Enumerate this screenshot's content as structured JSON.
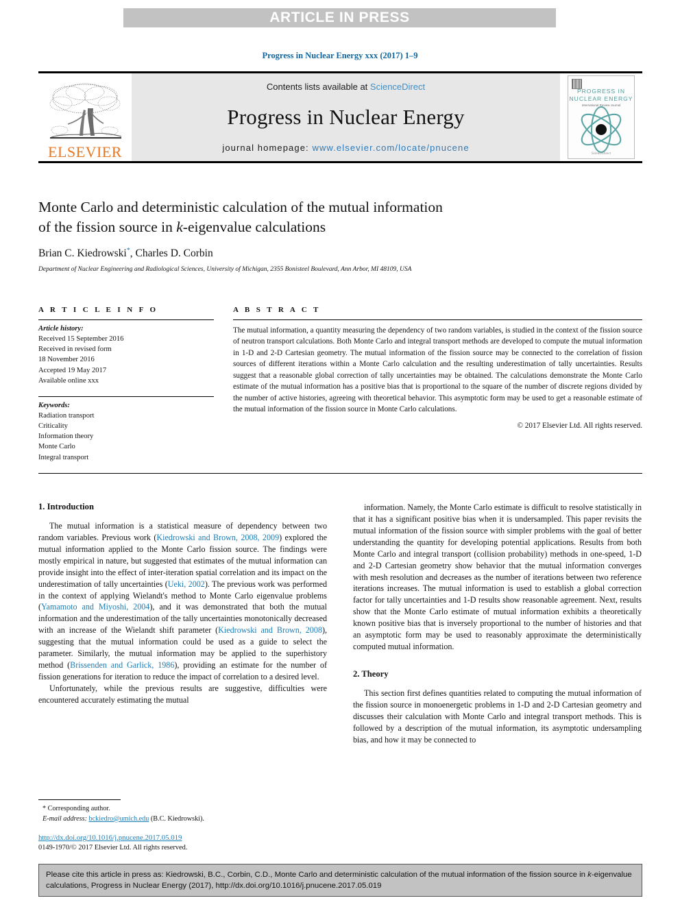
{
  "banner": {
    "text": "ARTICLE IN PRESS"
  },
  "running_head": "Progress in Nuclear Energy xxx (2017) 1–9",
  "masthead": {
    "contents_prefix": "Contents lists available at ",
    "sciencedirect": "ScienceDirect",
    "journal_title": "Progress in Nuclear Energy",
    "homepage_prefix": "journal homepage: ",
    "homepage_url": "www.elsevier.com/locate/pnucene",
    "publisher": "ELSEVIER",
    "cover": {
      "line1": "PROGRESS IN",
      "line2": "NUCLEAR ENERGY",
      "subtitle": "International Review Journal",
      "footer": "ScienceDirect"
    }
  },
  "article": {
    "title_line1": "Monte Carlo and deterministic calculation of the mutual information",
    "title_line2_a": "of the fission source in ",
    "title_line2_italic": "k",
    "title_line2_b": "-eigenvalue calculations",
    "authors": "Brian C. Kiedrowski",
    "author_marker": "*",
    "authors_rest": ", Charles D. Corbin",
    "affiliation": "Department of Nuclear Engineering and Radiological Sciences, University of Michigan, 2355 Bonisteel Boulevard, Ann Arbor, MI 48109, USA"
  },
  "info": {
    "heading": "A R T I C L E   I N F O",
    "history_label": "Article history:",
    "history": [
      "Received 15 September 2016",
      "Received in revised form",
      "18 November 2016",
      "Accepted 19 May 2017",
      "Available online xxx"
    ],
    "keywords_label": "Keywords:",
    "keywords": [
      "Radiation transport",
      "Criticality",
      "Information theory",
      "Monte Carlo",
      "Integral transport"
    ]
  },
  "abstract": {
    "heading": "A B S T R A C T",
    "text": "The mutual information, a quantity measuring the dependency of two random variables, is studied in the context of the fission source of neutron transport calculations. Both Monte Carlo and integral transport methods are developed to compute the mutual information in 1-D and 2-D Cartesian geometry. The mutual information of the fission source may be connected to the correlation of fission sources of different iterations within a Monte Carlo calculation and the resulting underestimation of tally uncertainties. Results suggest that a reasonable global correction of tally uncertainties may be obtained. The calculations demonstrate the Monte Carlo estimate of the mutual information has a positive bias that is proportional to the square of the number of discrete regions divided by the number of active histories, agreeing with theoretical behavior. This asymptotic form may be used to get a reasonable estimate of the mutual information of the fission source in Monte Carlo calculations.",
    "copyright": "© 2017 Elsevier Ltd. All rights reserved."
  },
  "body": {
    "left": {
      "section_heading": "1. Introduction",
      "p1_a": "The mutual information is a statistical measure of dependency between two random variables. Previous work (",
      "p1_ref1": "Kiedrowski and Brown, 2008, 2009",
      "p1_b": ") explored the mutual information applied to the Monte Carlo fission source. The findings were mostly empirical in nature, but suggested that estimates of the mutual information can provide insight into the effect of inter-iteration spatial correlation and its impact on the underestimation of tally uncertainties (",
      "p1_ref2": "Ueki, 2002",
      "p1_c": "). The previous work was performed in the context of applying Wielandt's method to Monte Carlo eigenvalue problems (",
      "p1_ref3": "Yamamoto and Miyoshi, 2004",
      "p1_d": "), and it was demonstrated that both the mutual information and the underestimation of the tally uncertainties monotonically decreased with an increase of the Wielandt shift parameter (",
      "p1_ref4": "Kiedrowski and Brown, 2008",
      "p1_e": "), suggesting that the mutual information could be used as a guide to select the parameter. Similarly, the mutual information may be applied to the superhistory method (",
      "p1_ref5": "Brissenden and Garlick, 1986",
      "p1_f": "), providing an estimate for the number of fission generations for iteration to reduce the impact of correlation to a desired level.",
      "p2": "Unfortunately, while the previous results are suggestive, difficulties were encountered accurately estimating the mutual"
    },
    "right": {
      "p1": "information. Namely, the Monte Carlo estimate is difficult to resolve statistically in that it has a significant positive bias when it is undersampled. This paper revisits the mutual information of the fission source with simpler problems with the goal of better understanding the quantity for developing potential applications. Results from both Monte Carlo and integral transport (collision probability) methods in one-speed, 1-D and 2-D Cartesian geometry show behavior that the mutual information converges with mesh resolution and decreases as the number of iterations between two reference iterations increases. The mutual information is used to establish a global correction factor for tally uncertainties and 1-D results show reasonable agreement. Next, results show that the Monte Carlo estimate of mutual information exhibits a theoretically known positive bias that is inversely proportional to the number of histories and that an asymptotic form may be used to reasonably approximate the deterministically computed mutual information.",
      "section_heading": "2. Theory",
      "p2": "This section first defines quantities related to computing the mutual information of the fission source in monoenergetic problems in 1-D and 2-D Cartesian geometry and discusses their calculation with Monte Carlo and integral transport methods. This is followed by a description of the mutual information, its asymptotic undersampling bias, and how it may be connected to"
    }
  },
  "footnote": {
    "corresponding": "* Corresponding author.",
    "email_label": "E-mail address:",
    "email": "bckiedro@umich.edu",
    "email_owner": "(B.C. Kiedrowski).",
    "doi": "http://dx.doi.org/10.1016/j.pnucene.2017.05.019",
    "issn": "0149-1970/© 2017 Elsevier Ltd. All rights reserved."
  },
  "cite_box": {
    "line1_a": "Please cite this article in press as: Kiedrowski, B.C., Corbin, C.D., Monte Carlo and deterministic calculation of the mutual information of the",
    "line2_a": "fission source in ",
    "line2_italic": "k",
    "line2_b": "-eigenvalue calculations, Progress in Nuclear Energy (2017), http://dx.doi.org/10.1016/j.pnucene.2017.05.019"
  },
  "colors": {
    "link": "#1a7db8",
    "banner_bg": "#c2c2c2",
    "masthead_bg": "#e7e7e7",
    "elsevier_orange": "#e87722",
    "cover_teal": "#4d9c9c"
  }
}
